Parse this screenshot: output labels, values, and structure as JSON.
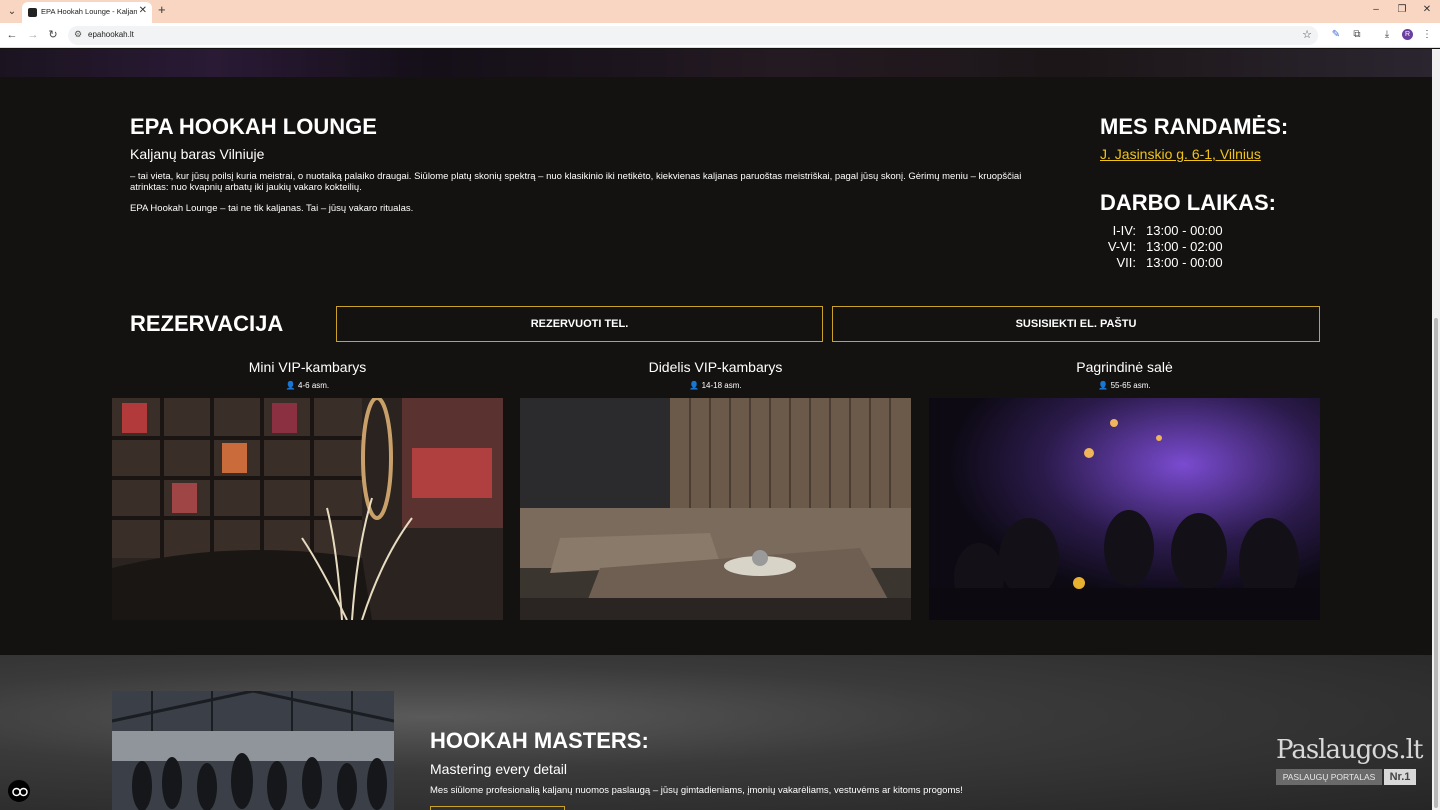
{
  "browser": {
    "tab_title": "EPA Hookah Lounge - Kaljanų B",
    "url": "epahookah.lt",
    "profile_initial": "R"
  },
  "about": {
    "title": "EPA HOOKAH LOUNGE",
    "subtitle": "Kaljanų baras Vilniuje",
    "paragraph1": "– tai vieta, kur jūsų poilsį kuria meistrai, o nuotaiką palaiko draugai. Siūlome platų skonių spektrą – nuo klasikinio iki netikėto, kiekvienas kaljanas paruoštas meistriškai, pagal jūsų skonį. Gėrimų meniu – kruopščiai atrinktas: nuo kvapnių arbatų iki jaukių vakaro kokteilių.",
    "paragraph2": "EPA Hookah Lounge – tai ne tik kaljanas. Tai – jūsų vakaro ritualas."
  },
  "location": {
    "title": "MES RANDAMĖS:",
    "address": "J. Jasinskio g. 6-1, Vilnius",
    "hours_title": "DARBO LAIKAS:",
    "hours": [
      {
        "days": "I-IV:",
        "time": "13:00 - 00:00"
      },
      {
        "days": "V-VI:",
        "time": "13:00 - 02:00"
      },
      {
        "days": "VII:",
        "time": "13:00 - 00:00"
      }
    ]
  },
  "reservation": {
    "title": "REZERVACIJA",
    "call_button": "REZERVUOTI TEL.",
    "email_button": "SUSISIEKTI EL. PAŠTU"
  },
  "rooms": [
    {
      "name": "Mini VIP-kambarys",
      "capacity": "4-6 asm."
    },
    {
      "name": "Didelis VIP-kambarys",
      "capacity": "14-18 asm."
    },
    {
      "name": "Pagrindinė salė",
      "capacity": "55-65 asm."
    }
  ],
  "masters": {
    "title": "HOOKAH MASTERS:",
    "subtitle": "Mastering every detail",
    "text": "Mes siūlome profesionalią kaljanų nuomos paslaugą – jūsų gimtadieniams, įmonių vakarėliams, vestuvėms ar kitoms progoms!"
  },
  "badge": {
    "name": "Paslaugos.lt",
    "tagline": "PASLAUGŲ PORTALAS",
    "rank": "Nr.1"
  },
  "colors": {
    "accent_gold": "#c9a227",
    "link_gold": "#f0c419",
    "background": "#141210"
  }
}
